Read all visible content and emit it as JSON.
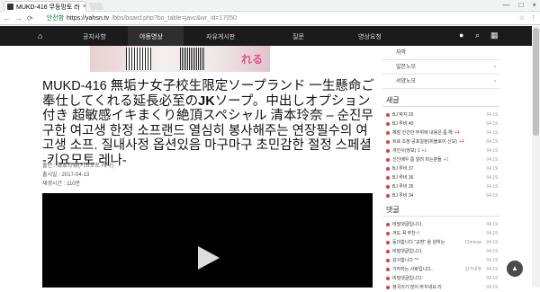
{
  "browser": {
    "tab_title": "MUKD-416 무등망토 러",
    "tab_close": "×",
    "nav_back": "←",
    "nav_forward": "→",
    "nav_reload": "⟳",
    "secure_label": "안전함",
    "url_host": "https://yahsn.tv",
    "url_path": "/bbs/board.php?bo_table=javc&wr_id=17050",
    "star": "☆",
    "menu": "⋮",
    "window_controls": [
      "—",
      "□",
      "×"
    ]
  },
  "navbar": {
    "home_icon": "⌂",
    "items": [
      "공지사항",
      "야동영상",
      "자유게시판",
      "질문",
      "영상요청"
    ],
    "active_index": 1,
    "icons": [
      "●",
      "⌕",
      "▦"
    ]
  },
  "banner": {
    "text": "れる"
  },
  "post": {
    "title_part1": "MUKD-416 無垢ナ女子校生限定ソープランド 一生懸命ご奉仕してくれる延長必至の",
    "title_bold": "JK",
    "title_part2": "ソープ。中出しオプション付き 超敏感イキまくり絶頂スペシャル 清本玲奈 – 순진무구한 여고생 한정 소프랜드 열심히 봉사해주는 연장필수의 여고생 소프. 질내사정 옵션있음 마구마구 초민감한 절정 스페셜 -키요모토 레나-",
    "meta": [
      "출연 : 清本玲奈(키요모토 레나)",
      "출시일 : 2017-04-13",
      "재생시간 : 110분"
    ]
  },
  "sidebar": {
    "items": [
      {
        "label": "자막"
      },
      {
        "label": "일본노모",
        "arrow": "›"
      },
      {
        "label": "서양노모",
        "arrow": "›"
      }
    ],
    "new_posts_title": "새글",
    "new_posts": [
      {
        "text": "BJ 박지 20",
        "count": "",
        "date": "04.19"
      },
      {
        "text": "BJ 루비 40",
        "count": "",
        "date": "04.19"
      },
      {
        "text": "제발 인간만 부위에 내용은 좀 해",
        "count": "+4",
        "date": "04.19"
      },
      {
        "text": "트로 초청 공포일분(위블로이 신보)",
        "count": "+4",
        "date": "04.19"
      },
      {
        "text": "개인사(정보) 1",
        "count": "+1",
        "date": "04.19"
      },
      {
        "text": "신인배우 좀 알려 피는분들",
        "count": "+1",
        "date": "04.19"
      },
      {
        "text": "BJ 루비 37",
        "count": "",
        "date": "04.19"
      },
      {
        "text": "BJ 루비 36",
        "count": "",
        "date": "04.19"
      },
      {
        "text": "BJ 루비 35",
        "count": "",
        "date": "04.19"
      },
      {
        "text": "BJ 루비 34",
        "count": "",
        "date": "04.19"
      }
    ],
    "comments_title": "댓글",
    "comments": [
      {
        "text": "비밀댓글입니다.",
        "who": "",
        "date": "04.19"
      },
      {
        "text": "겨도 꼭 추천~!",
        "who": "",
        "date": "04.19"
      },
      {
        "text": "동의합니다 \"교환\" 을 원하는",
        "who": "Chinese",
        "date": "04.19"
      },
      {
        "text": "비밀댓글입니다.",
        "who": "",
        "date": "04.19"
      },
      {
        "text": "감사합니다 ^^",
        "who": "",
        "date": "04.19"
      },
      {
        "text": "가자자는 사랑입니다..",
        "who": "김가네장",
        "date": "04.19"
      },
      {
        "text": "비밀댓글입니다.",
        "who": "",
        "date": "04.19"
      },
      {
        "text": "정국리가 많이 바꾸네요 리",
        "who": "",
        "date": "04.19"
      }
    ]
  },
  "to_top": "▲"
}
